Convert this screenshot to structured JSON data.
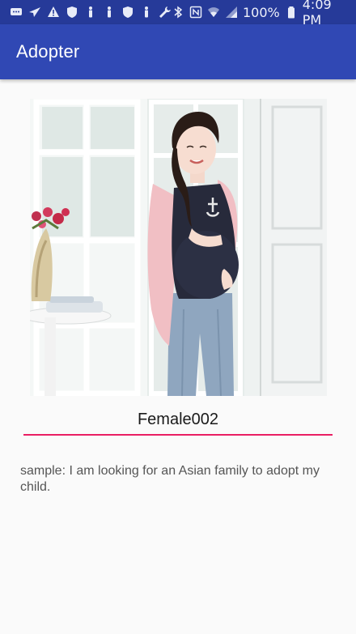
{
  "status_bar": {
    "battery_percent": "100%",
    "time": "4:09 PM",
    "left_icons": [
      "chat-icon",
      "send-icon",
      "warning-icon",
      "shield-icon",
      "figure-icon",
      "figure-icon",
      "shield-icon",
      "figure-icon",
      "wrench-icon"
    ],
    "right_icons": [
      "bluetooth-icon",
      "nfc-icon",
      "wifi-icon",
      "signal-icon",
      "battery-icon"
    ]
  },
  "app_bar": {
    "title": "Adopter"
  },
  "profile": {
    "photo_alt": "Female002",
    "name": "Female002",
    "description": "sample:  I am looking for an Asian family to adopt my child."
  },
  "colors": {
    "status_bar": "#263a99",
    "app_bar": "#3048b4",
    "accent_underline": "#e91e63",
    "background": "#fafafa"
  }
}
